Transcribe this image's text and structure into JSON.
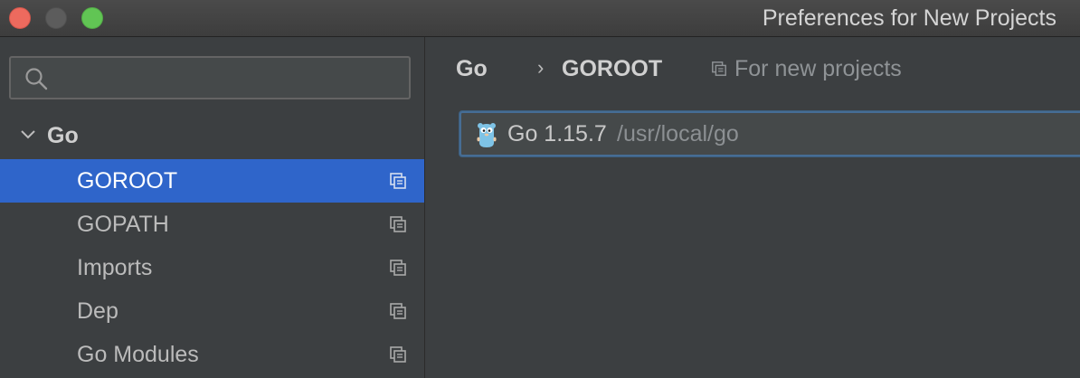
{
  "window": {
    "title": "Preferences for New Projects"
  },
  "sidebar": {
    "search": {
      "value": "",
      "placeholder": ""
    },
    "group": {
      "label": "Go",
      "expanded": true
    },
    "items": [
      {
        "label": "GOROOT",
        "selected": true,
        "icon": "project-scope-icon"
      },
      {
        "label": "GOPATH",
        "selected": false,
        "icon": "project-scope-icon"
      },
      {
        "label": "Imports",
        "selected": false,
        "icon": "project-scope-icon"
      },
      {
        "label": "Dep",
        "selected": false,
        "icon": "project-scope-icon"
      },
      {
        "label": "Go Modules",
        "selected": false,
        "icon": "project-scope-icon"
      }
    ]
  },
  "main": {
    "breadcrumb": [
      "Go",
      "GOROOT"
    ],
    "breadcrumb_separator": "›",
    "scope_note": "For new projects",
    "sdk": {
      "icon": "gopher-icon",
      "version": "Go 1.15.7",
      "path": "/usr/local/go"
    }
  },
  "colors": {
    "selection": "#2f65ca",
    "background": "#3c3f41",
    "focus_border": "#466d94",
    "close_button": "#ed6a5e",
    "maximize_button": "#61c554"
  }
}
